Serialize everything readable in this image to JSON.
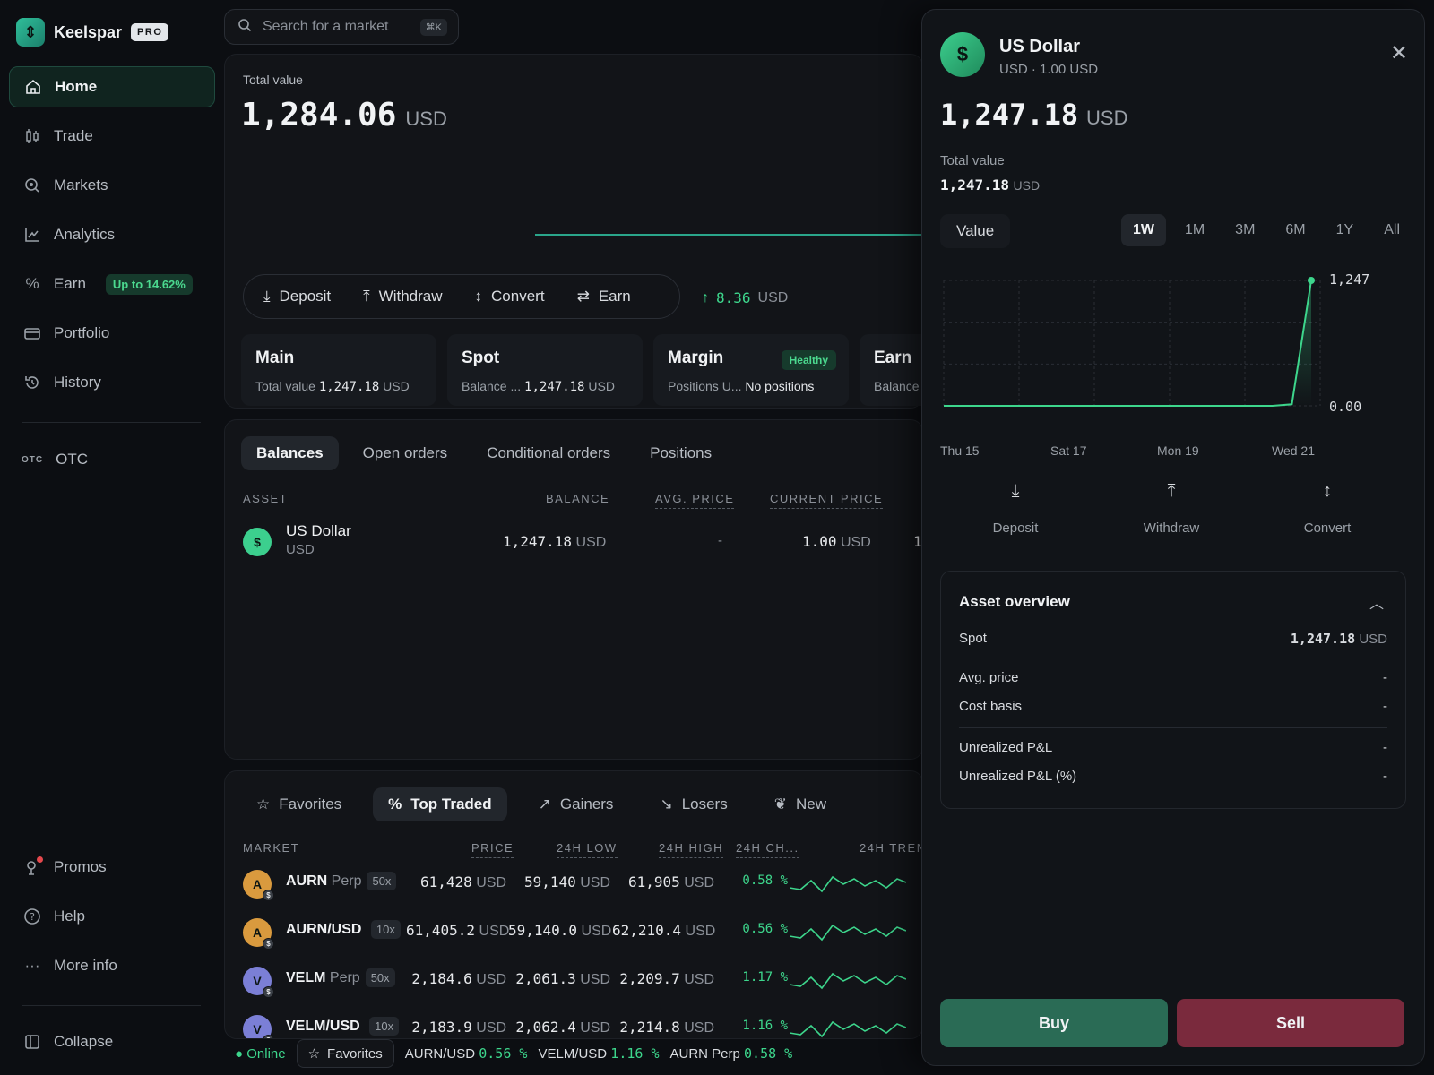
{
  "brand": {
    "name": "Keelspar",
    "badge": "PRO"
  },
  "nav": {
    "home": "Home",
    "trade": "Trade",
    "markets": "Markets",
    "analytics": "Analytics",
    "earn": "Earn",
    "earn_badge": "Up to 14.62%",
    "portfolio": "Portfolio",
    "history": "History",
    "otc_tag": "OTC",
    "otc": "OTC",
    "promos": "Promos",
    "help": "Help",
    "more": "More info",
    "collapse": "Collapse"
  },
  "search": {
    "placeholder": "Search for a market",
    "shortcut": "⌘K"
  },
  "summary": {
    "label": "Total value",
    "value": "1,284.06",
    "unit": "USD",
    "change": "8.36",
    "change_unit": "USD"
  },
  "actions": {
    "deposit": "Deposit",
    "withdraw": "Withdraw",
    "convert": "Convert",
    "earn": "Earn"
  },
  "accounts": {
    "main": {
      "title": "Main",
      "sub_label": "Total value",
      "value": "1,247.18",
      "unit": "USD"
    },
    "spot": {
      "title": "Spot",
      "sub_label": "Balance ...",
      "value": "1,247.18",
      "unit": "USD"
    },
    "margin": {
      "title": "Margin",
      "badge": "Healthy",
      "sub_label": "Positions U...",
      "value": "No positions"
    },
    "earn": {
      "title": "Earn",
      "sub_label": "Balance"
    }
  },
  "balances": {
    "tabs": [
      "Balances",
      "Open orders",
      "Conditional orders",
      "Positions"
    ],
    "headers": {
      "asset": "ASSET",
      "balance": "BALANCE",
      "avg": "AVG. PRICE",
      "current": "CURRENT PRICE"
    },
    "row": {
      "name": "US Dollar",
      "code": "USD",
      "symbol": "$",
      "balance": "1,247.18",
      "balance_unit": "USD",
      "avg": "-",
      "price": "1.00",
      "price_unit": "USD",
      "cut": "1"
    }
  },
  "markets": {
    "tabs": [
      "Favorites",
      "Top Traded",
      "Gainers",
      "Losers",
      "New"
    ],
    "headers": {
      "market": "MARKET",
      "price": "PRICE",
      "low": "24H LOW",
      "high": "24H HIGH",
      "change": "24H CH...",
      "trend": "24H TREN"
    },
    "rows": [
      {
        "letter": "A",
        "name": "AURN",
        "type": "Perp",
        "lev": "50x",
        "price": "61,428",
        "low": "59,140",
        "high": "61,905",
        "unit": "USD",
        "change": "0.58 %",
        "color": "#d99a3e"
      },
      {
        "letter": "A",
        "name": "AURN/USD",
        "type": "",
        "lev": "10x",
        "price": "61,405.2",
        "low": "59,140.0",
        "high": "62,210.4",
        "unit": "USD",
        "change": "0.56 %",
        "color": "#d99a3e"
      },
      {
        "letter": "V",
        "name": "VELM",
        "type": "Perp",
        "lev": "50x",
        "price": "2,184.6",
        "low": "2,061.3",
        "high": "2,209.7",
        "unit": "USD",
        "change": "1.17 %",
        "color": "#7b7fd6"
      },
      {
        "letter": "V",
        "name": "VELM/USD",
        "type": "",
        "lev": "10x",
        "price": "2,183.9",
        "low": "2,062.4",
        "high": "2,214.8",
        "unit": "USD",
        "change": "1.16 %",
        "color": "#7b7fd6"
      }
    ]
  },
  "footer": {
    "status": "Online",
    "favorites": "Favorites",
    "t1": "AURN/USD",
    "c1": "0.56 %",
    "t2": "VELM/USD",
    "c2": "1.16 %",
    "t3": "AURN Perp",
    "c3": "0.58 %"
  },
  "drawer": {
    "symbol": "$",
    "name": "US Dollar",
    "sub": "USD · 1.00 USD",
    "value": "1,247.18",
    "unit": "USD",
    "tv_label": "Total value",
    "tv_value": "1,247.18",
    "tv_unit": "USD",
    "metric": "Value",
    "ranges": [
      "1W",
      "1M",
      "3M",
      "6M",
      "1Y",
      "All"
    ],
    "chart_labels": {
      "top": "1,247",
      "bottom": "0.00"
    },
    "x_labels": [
      "Thu 15",
      "Sat 17",
      "Mon 19",
      "Wed 21"
    ],
    "actions": {
      "deposit": "Deposit",
      "withdraw": "Withdraw",
      "convert": "Convert"
    },
    "overview": {
      "title": "Asset overview",
      "spot_label": "Spot",
      "spot_value": "1,247.18",
      "spot_unit": "USD",
      "avg_label": "Avg. price",
      "avg": "-",
      "cost_label": "Cost basis",
      "cost": "-",
      "upl_label": "Unrealized P&L",
      "upl": "-",
      "uplp_label": "Unrealized P&L (%)",
      "uplp": "-"
    },
    "buy": "Buy",
    "sell": "Sell"
  },
  "chart_data": {
    "type": "area",
    "x": [
      "Thu 15",
      "Sat 17",
      "Mon 19",
      "Wed 21"
    ],
    "series": [
      {
        "values": [
          0,
          0,
          0,
          0,
          0,
          0,
          0,
          0,
          0,
          0,
          0,
          0,
          0,
          0,
          0,
          0,
          0,
          0,
          15,
          1247
        ]
      }
    ],
    "ylim": [
      0,
      1247
    ],
    "grid": true
  }
}
